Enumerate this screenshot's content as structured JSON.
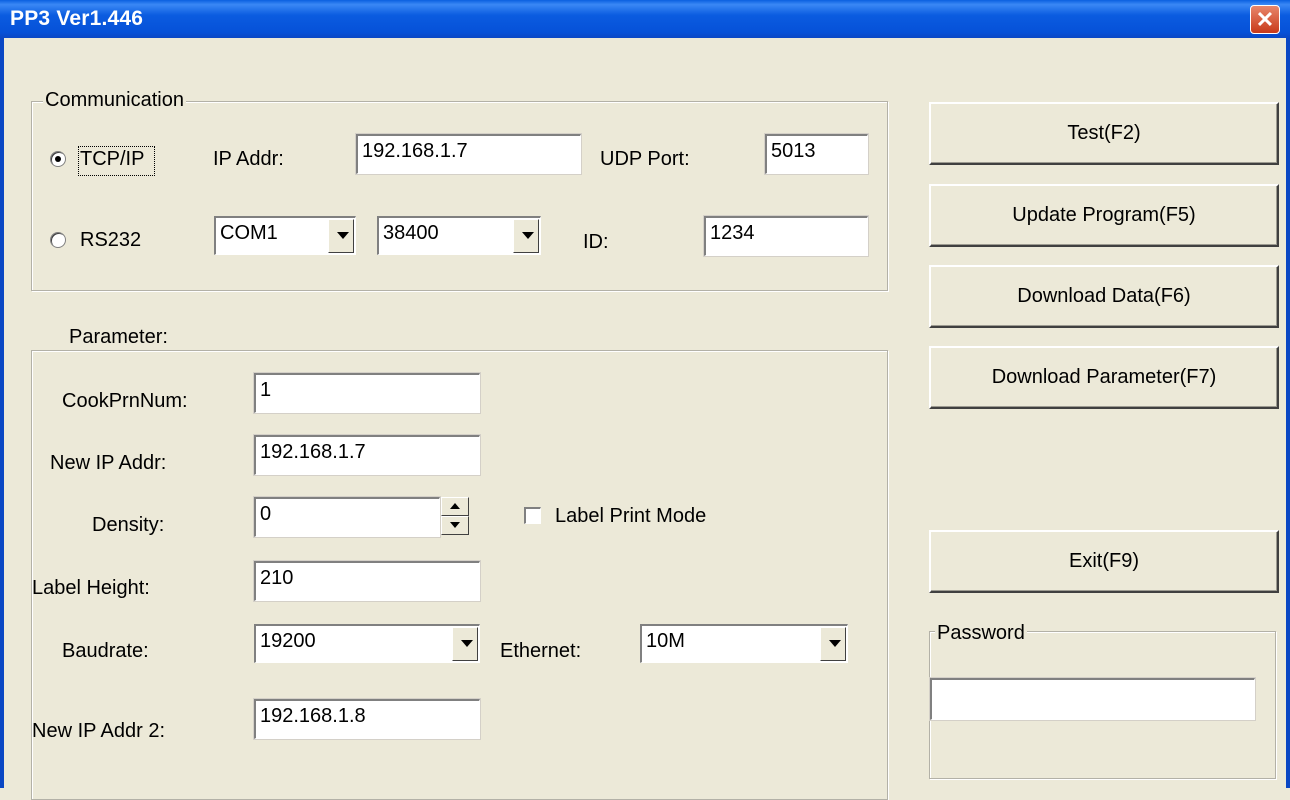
{
  "window": {
    "title": "PP3 Ver1.446",
    "close_glyph": "✕"
  },
  "communication": {
    "legend": "Communication",
    "tcpip_label": "TCP/IP",
    "tcpip_selected": true,
    "rs232_label": "RS232",
    "rs232_selected": false,
    "ip_addr_label": "IP Addr:",
    "ip_addr_value": "192.168.1.7",
    "udp_port_label": "UDP Port:",
    "udp_port_value": "5013",
    "com_port_value": "COM1",
    "baud_value": "38400",
    "id_label": "ID:",
    "id_value": "1234"
  },
  "parameter": {
    "legend": "Parameter:",
    "cook_prn_num_label": "CookPrnNum:",
    "cook_prn_num_value": "1",
    "new_ip_label": "New IP Addr:",
    "new_ip_value": "192.168.1.7",
    "density_label": "Density:",
    "density_value": "0",
    "label_print_mode_label": "Label Print Mode",
    "label_print_mode_checked": false,
    "label_height_label": "Label Height:",
    "label_height_value": "210",
    "baudrate_label": "Baudrate:",
    "baudrate_value": "19200",
    "ethernet_label": "Ethernet:",
    "ethernet_value": "10M",
    "new_ip2_label": "New IP Addr 2:",
    "new_ip2_value": "192.168.1.8"
  },
  "buttons": {
    "test": "Test(F2)",
    "update_program": "Update Program(F5)",
    "download_data": "Download Data(F6)",
    "download_parameter": "Download Parameter(F7)",
    "exit": "Exit(F9)"
  },
  "password": {
    "legend": "Password",
    "value": ""
  },
  "colors": {
    "title_bar": "#0a5fe0",
    "face": "#ece9d8",
    "close": "#c8391a"
  }
}
